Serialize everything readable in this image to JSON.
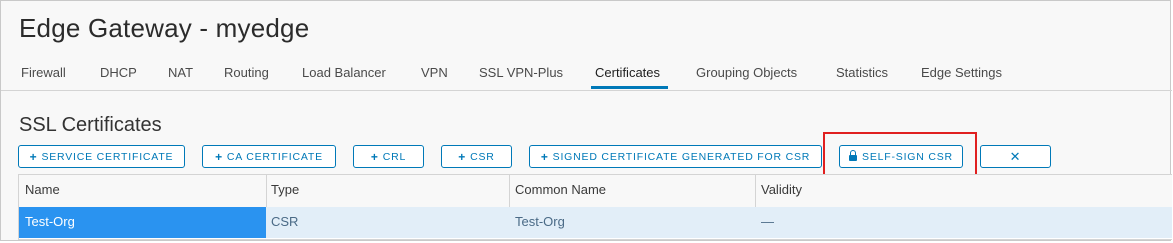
{
  "page": {
    "title": "Edge Gateway - myedge"
  },
  "tabs": [
    {
      "label": "Firewall"
    },
    {
      "label": "DHCP"
    },
    {
      "label": "NAT"
    },
    {
      "label": "Routing"
    },
    {
      "label": "Load Balancer"
    },
    {
      "label": "VPN"
    },
    {
      "label": "SSL VPN-Plus"
    },
    {
      "label": "Certificates",
      "active": true
    },
    {
      "label": "Grouping Objects"
    },
    {
      "label": "Statistics"
    },
    {
      "label": "Edge Settings"
    }
  ],
  "section": {
    "title": "SSL Certificates"
  },
  "toolbar": {
    "service_certificate": "SERVICE CERTIFICATE",
    "ca_certificate": "CA CERTIFICATE",
    "crl": "CRL",
    "csr": "CSR",
    "signed_certificate": "SIGNED CERTIFICATE GENERATED FOR CSR",
    "self_sign_csr": "SELF-SIGN CSR",
    "plus_icon": "plus-icon",
    "lock_icon": "lock-icon",
    "delete_icon": "close-icon"
  },
  "grid": {
    "columns": [
      "Name",
      "Type",
      "Common Name",
      "Validity"
    ],
    "rows": [
      {
        "name": "Test-Org",
        "type": "CSR",
        "common_name": "Test-Org",
        "validity": "—",
        "selected": true
      }
    ]
  },
  "colors": {
    "accent": "#0079b8",
    "selected_row": "#2a93f0",
    "row_highlight": "#e2eef8",
    "annotation": "#e02020"
  }
}
